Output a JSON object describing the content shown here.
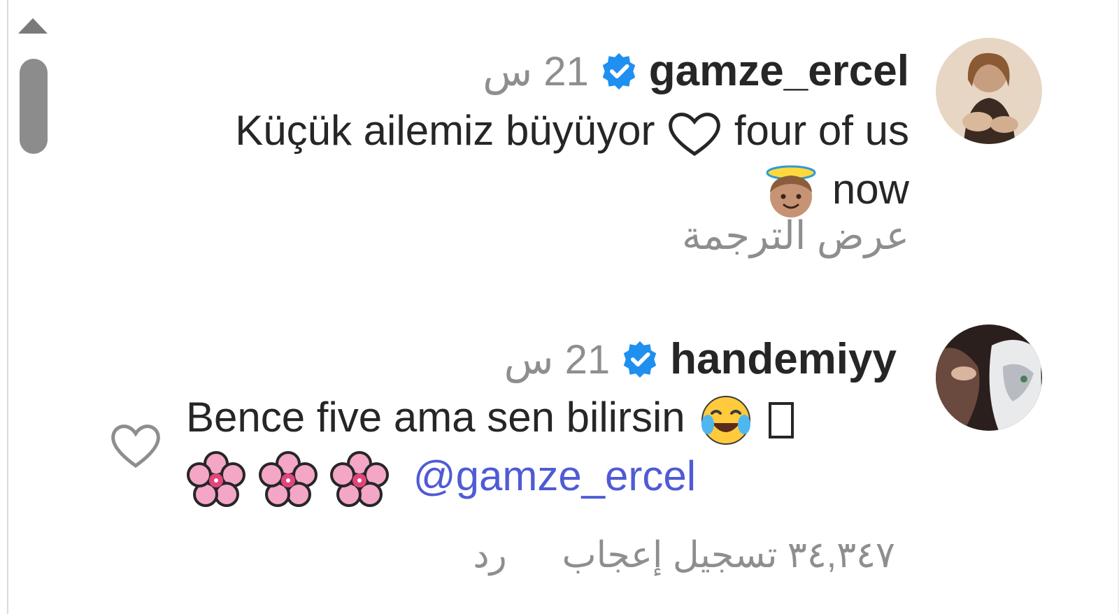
{
  "comments": [
    {
      "username": "gamze_ercel",
      "time": "21 س",
      "verified": true,
      "line1": "Küçük ailemiz büyüyor",
      "line1_tail": "four of us",
      "line2": "now",
      "translate": "عرض الترجمة",
      "emojis": [
        "white-heart",
        "baby-angel"
      ]
    },
    {
      "username": "handemiyy",
      "time": "21 س",
      "verified": true,
      "line1": "Bence five ama sen bilirsin",
      "mention": "@gamze_ercel",
      "likes_count": "٣٤,٣٤٧",
      "likes_label": "تسجيل إعجاب",
      "reply_label": "رد",
      "emojis": [
        "tears-of-joy",
        "cherry-blossom",
        "cherry-blossom",
        "cherry-blossom"
      ]
    }
  ],
  "colors": {
    "verified_blue": "#1f8ff0",
    "mention": "#4f5bd5",
    "secondary_text": "#8e8e8e"
  }
}
